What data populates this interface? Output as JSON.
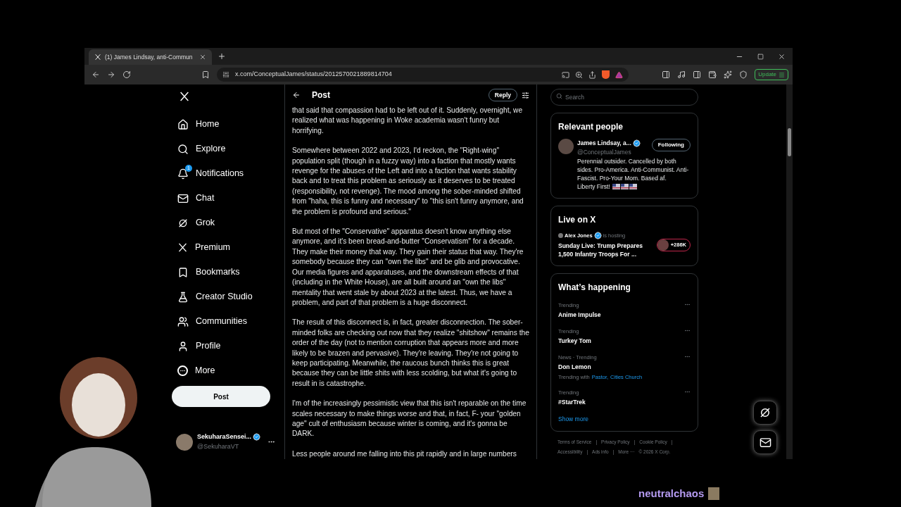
{
  "browser": {
    "tab_title": "(1) James Lindsay, anti-Commun",
    "url": "x.com/ConceptualJames/status/2012570021889814704",
    "update_label": "Update"
  },
  "sidebar": {
    "items": [
      {
        "label": "Home",
        "kind": "home"
      },
      {
        "label": "Explore",
        "kind": "search"
      },
      {
        "label": "Notifications",
        "kind": "bell",
        "badge": "1"
      },
      {
        "label": "Chat",
        "kind": "mail"
      },
      {
        "label": "Grok",
        "kind": "grok"
      },
      {
        "label": "Premium",
        "kind": "x"
      },
      {
        "label": "Bookmarks",
        "kind": "bookmark"
      },
      {
        "label": "Creator Studio",
        "kind": "flask"
      },
      {
        "label": "Communities",
        "kind": "people"
      },
      {
        "label": "Profile",
        "kind": "person"
      },
      {
        "label": "More",
        "kind": "more"
      }
    ],
    "post_button": "Post",
    "account": {
      "name": "SekuharaSensei...",
      "handle": "@SekuharaVT"
    }
  },
  "post": {
    "title": "Post",
    "reply_label": "Reply",
    "paragraphs": [
      "that said that compassion had to be left out of it. Suddenly, overnight, we realized what was happening in Woke academia wasn't funny but horrifying.",
      "Somewhere between 2022 and 2023, I'd reckon, the \"Right-wing\" population split (though in a fuzzy way) into a faction that mostly wants revenge for the abuses of the Left and into a faction that wants stability back and to treat this problem as seriously as it deserves to be treated (responsibility, not revenge). The mood among the sober-minded shifted from \"haha, this is funny and necessary\" to \"this isn't funny anymore, and the problem is profound and serious.\"",
      "But most of the \"Conservative\" apparatus doesn't know anything else anymore, and it's been bread-and-butter \"Conservatism\" for a decade. They make their money that way. They gain their status that way. They're somebody because they can \"own the libs\" and be glib and provocative. Our media figures and apparatuses, and the downstream effects of that (including in the White House), are all built around an \"own the libs\" mentality that went stale by about 2023 at the latest. Thus, we have a problem, and part of that problem is a huge disconnect.",
      "The result of this disconnect is, in fact, greater disconnection. The sober-minded folks are checking out now that they realize \"shitshow\" remains the order of the day (not to mention corruption that appears more and more likely to be brazen and pervasive). They're leaving. They're not going to keep participating. Meanwhile, the raucous bunch thinks this is great because they can be little shits with less scolding, but what it's going to result in is catastrophe.",
      "I'm of the increasingly pessimistic view that this isn't reparable on the time scales necessary to make things worse and that, in fact, F- your \"golden age\" cult of enthusiasm because winter is coming, and it's gonna be DARK.",
      "Less people around me falling into this pit rapidly and in large numbers"
    ]
  },
  "right": {
    "search_placeholder": "Search",
    "relevant": {
      "title": "Relevant people",
      "name": "James Lindsay, a...",
      "handle": "@ConceptualJames",
      "follow_label": "Following",
      "bio": "Perennial outsider. Cancelled by both sides. Pro-America. Anti-Communist. Anti-Fascist. Pro-Your Mom. Based af.",
      "bio_end": "Liberty First!"
    },
    "live": {
      "title": "Live on X",
      "host": "Alex Jones",
      "status": "is hosting",
      "headline": "Sunday Live: Trump Prepares 1,500 Infantry Troops For ...",
      "count": "+286K"
    },
    "trends": {
      "title": "What’s happening",
      "items": [
        {
          "meta": "Trending",
          "topic": "Anime Impulse"
        },
        {
          "meta": "Trending",
          "topic": "Turkey Tom"
        },
        {
          "meta": "News · Trending",
          "topic": "Don Lemon",
          "context": "Trending with",
          "links": [
            "Pastor,",
            "Cities Church"
          ]
        },
        {
          "meta": "Trending",
          "topic": "#StarTrek"
        }
      ],
      "show_more": "Show more"
    },
    "footer": [
      "Terms of Service",
      "|",
      "Privacy Policy",
      "|",
      "Cookie Policy",
      "|",
      "Accessibility",
      "|",
      "Ads info",
      "|",
      "More ···",
      "© 2026 X Corp."
    ]
  },
  "overlay": {
    "streamer": "neutralchaos"
  }
}
